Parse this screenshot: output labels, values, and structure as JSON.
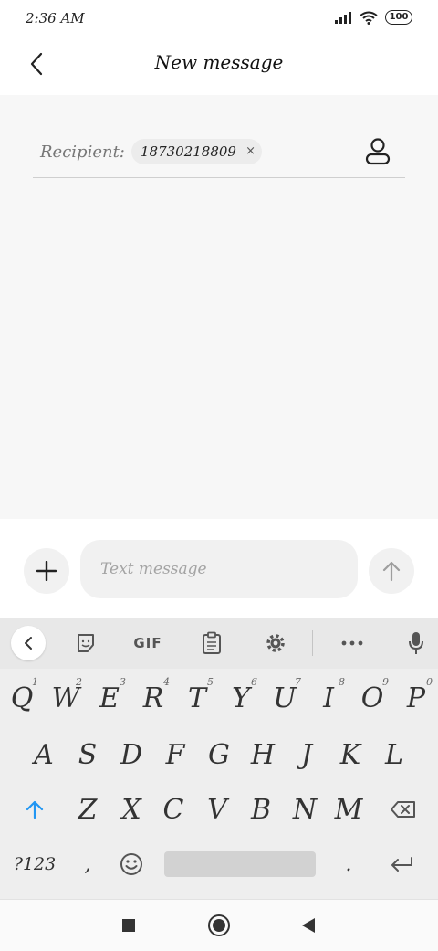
{
  "status": {
    "time": "2:36 AM",
    "battery": "100"
  },
  "header": {
    "title": "New message"
  },
  "recipient": {
    "label": "Recipient:",
    "chip_number": "18730218809",
    "chip_remove": "×"
  },
  "compose": {
    "placeholder": "Text message"
  },
  "keyboard": {
    "toolbar": {
      "gif_label": "GIF"
    },
    "row1": [
      {
        "key": "Q",
        "hint": "1"
      },
      {
        "key": "W",
        "hint": "2"
      },
      {
        "key": "E",
        "hint": "3"
      },
      {
        "key": "R",
        "hint": "4"
      },
      {
        "key": "T",
        "hint": "5"
      },
      {
        "key": "Y",
        "hint": "6"
      },
      {
        "key": "U",
        "hint": "7"
      },
      {
        "key": "I",
        "hint": "8"
      },
      {
        "key": "O",
        "hint": "9"
      },
      {
        "key": "P",
        "hint": "0"
      }
    ],
    "row2": [
      "A",
      "S",
      "D",
      "F",
      "G",
      "H",
      "J",
      "K",
      "L"
    ],
    "row3": [
      "Z",
      "X",
      "C",
      "V",
      "B",
      "N",
      "M"
    ],
    "row4": {
      "symbols": "?123",
      "comma": ",",
      "period": "."
    }
  },
  "colors": {
    "accent": "#2196f3",
    "background": "#f7f7f7",
    "keyboard": "#eeeeee"
  },
  "icons": [
    "signal-icon",
    "wifi-icon",
    "battery-icon",
    "back-arrow-icon",
    "contact-icon",
    "plus-icon",
    "send-arrow-icon",
    "chevron-left-icon",
    "sticker-icon",
    "clipboard-icon",
    "gear-icon",
    "more-dots-icon",
    "microphone-icon",
    "shift-icon",
    "emoji-icon",
    "backspace-icon",
    "enter-icon",
    "recents-square-icon",
    "home-circle-icon",
    "back-triangle-icon"
  ]
}
